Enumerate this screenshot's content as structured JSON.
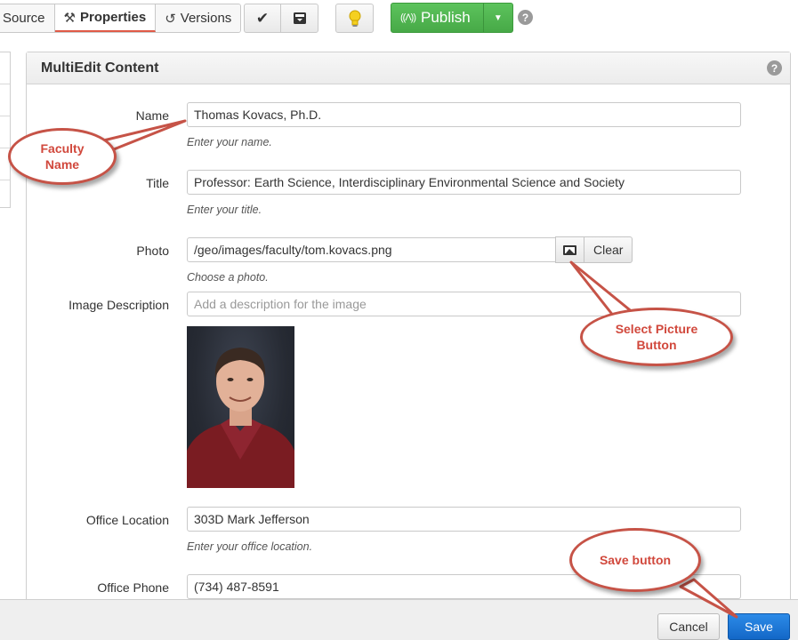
{
  "toolbar": {
    "tabs": [
      {
        "label": "Source"
      },
      {
        "label": "Properties"
      },
      {
        "label": "Versions"
      }
    ],
    "publish_label": "Publish"
  },
  "panel": {
    "title": "MultiEdit Content"
  },
  "form": {
    "name": {
      "label": "Name",
      "value": "Thomas Kovacs, Ph.D.",
      "hint": "Enter your name."
    },
    "title": {
      "label": "Title",
      "value": "Professor: Earth Science, Interdisciplinary Environmental Science and Society",
      "hint": "Enter your title."
    },
    "photo": {
      "label": "Photo",
      "value": "/geo/images/faculty/tom.kovacs.png",
      "hint": "Choose a photo.",
      "clear_label": "Clear"
    },
    "image_description": {
      "label": "Image Description",
      "placeholder": "Add a description for the image"
    },
    "office_location": {
      "label": "Office Location",
      "value": "303D Mark Jefferson",
      "hint": "Enter your office location."
    },
    "office_phone": {
      "label": "Office Phone",
      "value": "(734) 487-8591"
    }
  },
  "callouts": {
    "faculty_name": {
      "line1": "Faculty",
      "line2": "Name"
    },
    "select_picture": {
      "line1": "Select Picture",
      "line2": "Button"
    },
    "save_button": {
      "line1": "Save button"
    }
  },
  "footer": {
    "cancel_label": "Cancel",
    "save_label": "Save"
  },
  "colors": {
    "publish_green": "#4cb34c",
    "save_blue": "#1a73d4",
    "callout_red": "#c65347",
    "active_tab_underline": "#e05a47"
  }
}
